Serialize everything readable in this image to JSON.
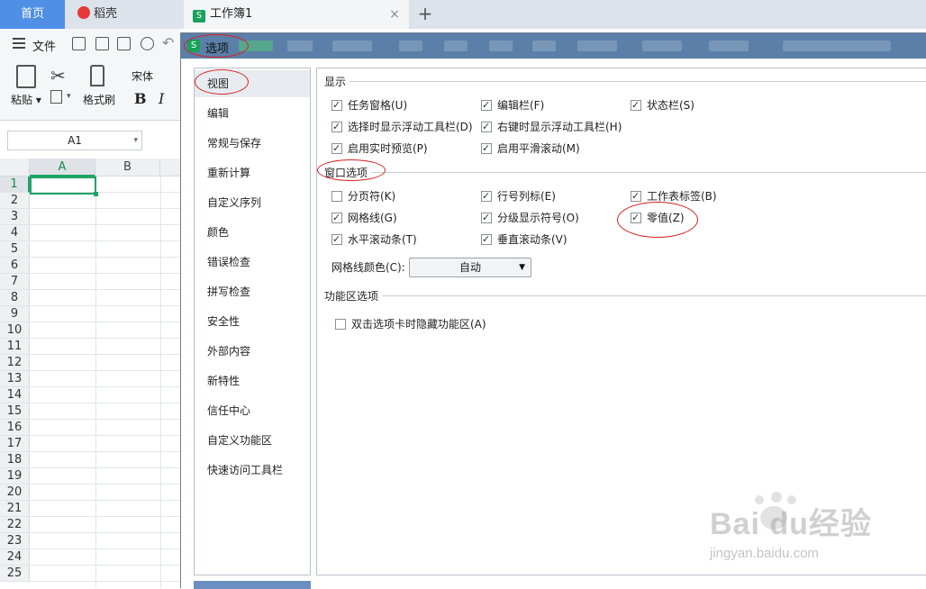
{
  "tabs": {
    "home": "首页",
    "daoke": "稻壳",
    "workbook": "工作簿1",
    "close_glyph": "×",
    "add_glyph": "+"
  },
  "toolbar": {
    "file_label": "文件",
    "menu_icon": "hamburger-icon",
    "quick_icons": [
      "save-icon",
      "export-icon",
      "print-icon",
      "preview-icon",
      "undo-icon"
    ]
  },
  "ribbon": {
    "paste_label": "粘贴",
    "format_painter_label": "格式刷",
    "font_name": "宋体",
    "bold_glyph": "B",
    "italic_glyph": "I"
  },
  "namebox": {
    "value": "A1"
  },
  "grid": {
    "columns": [
      "A",
      "B"
    ],
    "rows": [
      "1",
      "2",
      "3",
      "4",
      "5",
      "6",
      "7",
      "8",
      "9",
      "10",
      "11",
      "12",
      "13",
      "14",
      "15",
      "16",
      "17",
      "18",
      "19",
      "20",
      "21",
      "22",
      "23",
      "24",
      "25"
    ],
    "active_cell": "A1"
  },
  "dialog": {
    "title": "选项",
    "nav_items": [
      "视图",
      "编辑",
      "常规与保存",
      "重新计算",
      "自定义序列",
      "颜色",
      "错误检查",
      "拼写检查",
      "安全性",
      "外部内容",
      "新特性",
      "信任中心",
      "自定义功能区",
      "快速访问工具栏"
    ],
    "selected_nav": "视图",
    "sections": {
      "display": {
        "title": "显示",
        "options": [
          {
            "label": "任务窗格(U)",
            "checked": true
          },
          {
            "label": "编辑栏(F)",
            "checked": true
          },
          {
            "label": "状态栏(S)",
            "checked": true
          },
          {
            "label": "选择时显示浮动工具栏(D)",
            "checked": true
          },
          {
            "label": "右键时显示浮动工具栏(H)",
            "checked": true
          },
          {
            "label": "启用实时预览(P)",
            "checked": true
          },
          {
            "label": "启用平滑滚动(M)",
            "checked": true
          }
        ]
      },
      "window": {
        "title": "窗口选项",
        "options": [
          {
            "label": "分页符(K)",
            "checked": false
          },
          {
            "label": "行号列标(E)",
            "checked": true
          },
          {
            "label": "工作表标签(B)",
            "checked": true
          },
          {
            "label": "网格线(G)",
            "checked": true
          },
          {
            "label": "分级显示符号(O)",
            "checked": true
          },
          {
            "label": "零值(Z)",
            "checked": true
          },
          {
            "label": "水平滚动条(T)",
            "checked": true
          },
          {
            "label": "垂直滚动条(V)",
            "checked": true
          }
        ],
        "grid_color_label": "网格线颜色(C):",
        "grid_color_value": "自动"
      },
      "ribbon_options": {
        "title": "功能区选项",
        "options": [
          {
            "label": "双击选项卡时隐藏功能区(A)",
            "checked": false
          }
        ]
      }
    }
  },
  "watermark": {
    "brand": "Bai du经验",
    "url": "jingyan.baidu.com"
  },
  "colors": {
    "home_tab": "#4f8fe6",
    "dialog_title": "#5b7fa8",
    "annotation": "#d62020",
    "excel_green": "#21a366"
  }
}
